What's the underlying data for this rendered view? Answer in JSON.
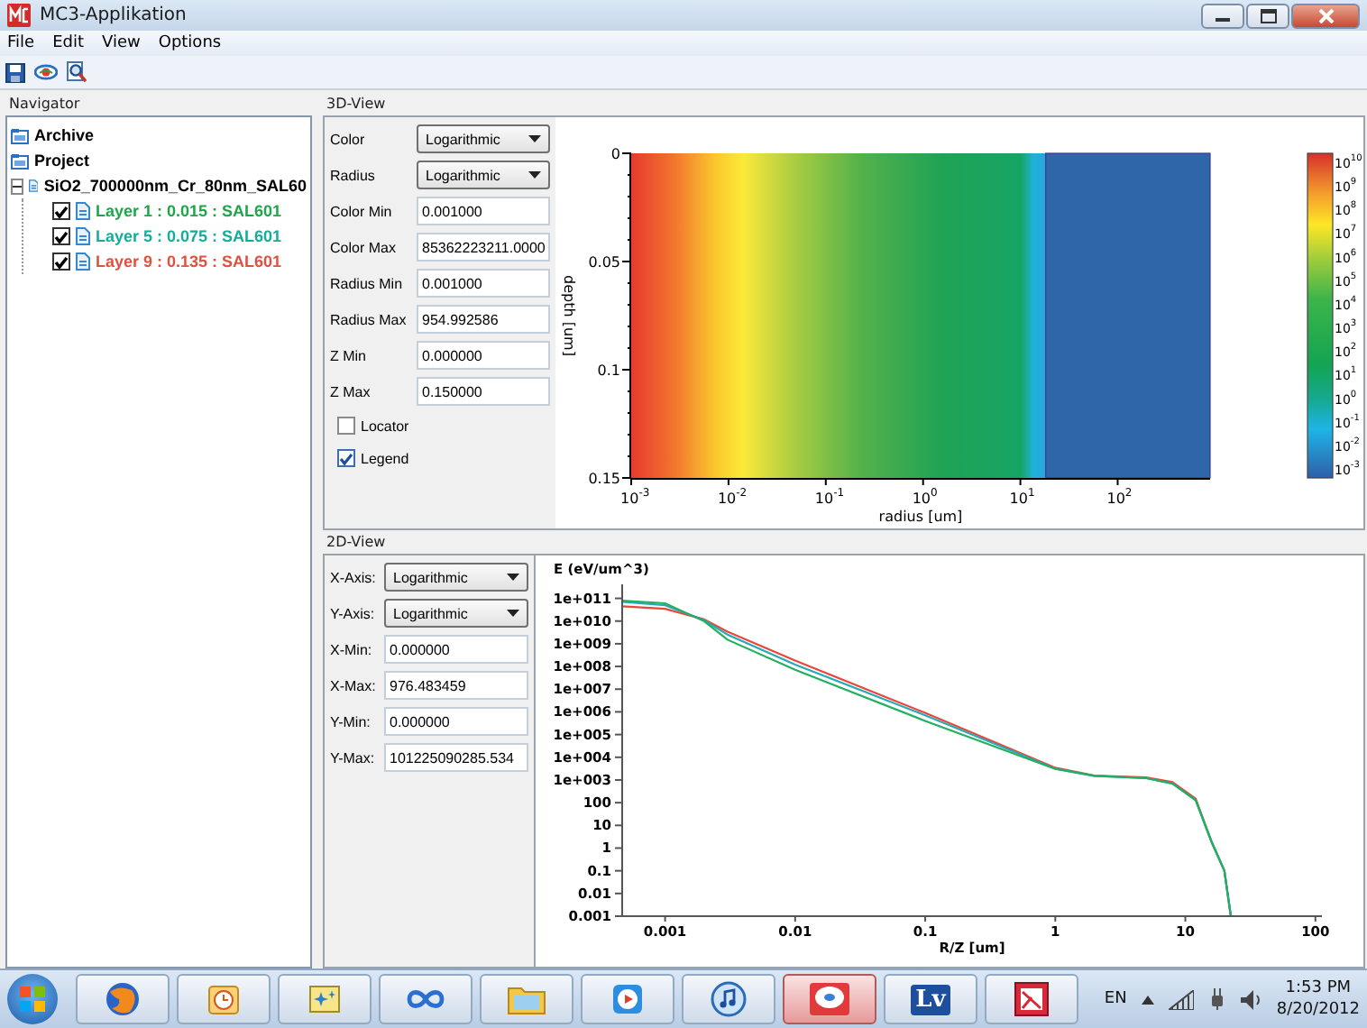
{
  "window": {
    "title": "MC3-Applikation"
  },
  "menu": [
    "File",
    "Edit",
    "View",
    "Options"
  ],
  "navigator": {
    "title": "Navigator",
    "items": [
      {
        "label": "Archive",
        "kind": "folder"
      },
      {
        "label": "Project",
        "kind": "folder"
      },
      {
        "label": "SiO2_700000nm_Cr_80nm_SAL60",
        "kind": "file",
        "expanded": true,
        "children": [
          {
            "label": "Layer 1 : 0.015 : SAL601",
            "kind": "file",
            "checked": true,
            "color": "#1fa64a"
          },
          {
            "label": "Layer 5 : 0.075 : SAL601",
            "kind": "file",
            "checked": true,
            "color": "#14ad9a"
          },
          {
            "label": "Layer 9 : 0.135 : SAL601",
            "kind": "file",
            "checked": true,
            "color": "#e2503e"
          }
        ]
      }
    ]
  },
  "view_3d": {
    "title": "3D-View",
    "controls": [
      {
        "kind": "select",
        "label": "Color",
        "value": "Logarithmic"
      },
      {
        "kind": "select",
        "label": "Radius",
        "value": "Logarithmic"
      },
      {
        "kind": "input",
        "label": "Color Min",
        "value": "0.001000"
      },
      {
        "kind": "input",
        "label": "Color Max",
        "value": "85362223211.0000"
      },
      {
        "kind": "input",
        "label": "Radius Min",
        "value": "0.001000"
      },
      {
        "kind": "input",
        "label": "Radius Max",
        "value": "954.992586"
      },
      {
        "kind": "input",
        "label": "Z Min",
        "value": "0.000000"
      },
      {
        "kind": "input",
        "label": "Z Max",
        "value": "0.150000"
      },
      {
        "kind": "checkbox",
        "label": "Locator",
        "checked": false
      },
      {
        "kind": "checkbox",
        "label": "Legend",
        "checked": true
      }
    ],
    "heatmap": {
      "xlabel": "radius [um]",
      "ylabel": "depth [um]",
      "xticks": [
        {
          "base": "10",
          "exponent": "-3"
        },
        {
          "base": "10",
          "exponent": "-2"
        },
        {
          "base": "10",
          "exponent": "-1"
        },
        {
          "base": "10",
          "exponent": "0"
        },
        {
          "base": "10",
          "exponent": "1"
        },
        {
          "base": "10",
          "exponent": "2"
        }
      ],
      "yticks": [
        "0",
        "0.05",
        "0.1",
        "0.15"
      ],
      "legend_ticks": [
        {
          "base": "10",
          "exponent": "10"
        },
        {
          "base": "10",
          "exponent": "9"
        },
        {
          "base": "10",
          "exponent": "8"
        },
        {
          "base": "10",
          "exponent": "7"
        },
        {
          "base": "10",
          "exponent": "6"
        },
        {
          "base": "10",
          "exponent": "5"
        },
        {
          "base": "10",
          "exponent": "4"
        },
        {
          "base": "10",
          "exponent": "3"
        },
        {
          "base": "10",
          "exponent": "2"
        },
        {
          "base": "10",
          "exponent": "1"
        },
        {
          "base": "10",
          "exponent": "0"
        },
        {
          "base": "10",
          "exponent": "-1"
        },
        {
          "base": "10",
          "exponent": "-2"
        },
        {
          "base": "10",
          "exponent": "-3"
        }
      ]
    }
  },
  "view_2d": {
    "title": "2D-View",
    "controls": [
      {
        "kind": "select",
        "label": "X-Axis:",
        "value": "Logarithmic"
      },
      {
        "kind": "select",
        "label": "Y-Axis:",
        "value": "Logarithmic"
      },
      {
        "kind": "input",
        "label": "X-Min:",
        "value": "0.000000"
      },
      {
        "kind": "input",
        "label": "X-Max:",
        "value": "976.483459"
      },
      {
        "kind": "input",
        "label": "Y-Min:",
        "value": "0.000000"
      },
      {
        "kind": "input",
        "label": "Y-Max:",
        "value": "101225090285.534"
      }
    ],
    "plot": {
      "xlabel": "R/Z [um]",
      "ylabel": "E (eV/um^3)",
      "lines": [
        {
          "color": "#e8473a"
        },
        {
          "color": "#2aa8b8"
        },
        {
          "color": "#22b060"
        }
      ],
      "xticks": [
        "0.001",
        "0.01",
        "0.1",
        "1",
        "10",
        "100"
      ],
      "yticks": [
        "1e+011",
        "1e+010",
        "1e+009",
        "1e+008",
        "1e+007",
        "1e+006",
        "1e+005",
        "1e+004",
        "1e+003",
        "100",
        "10",
        "1",
        "0.1",
        "0.01",
        "0.001"
      ]
    }
  },
  "taskbar": {
    "items": [
      {
        "kind": "browser",
        "selected": false
      },
      {
        "kind": "clock",
        "selected": false
      },
      {
        "kind": "sparkle",
        "selected": false
      },
      {
        "kind": "infinity",
        "selected": false
      },
      {
        "kind": "folder",
        "selected": false
      },
      {
        "kind": "video",
        "selected": false
      },
      {
        "kind": "music",
        "selected": false
      },
      {
        "kind": "disc",
        "selected": true
      },
      {
        "kind": "text",
        "label": "Lv",
        "selected": false
      },
      {
        "kind": "chart",
        "selected": false
      }
    ],
    "language": "EN",
    "time": "1:53 PM",
    "date": "8/20/2012"
  }
}
